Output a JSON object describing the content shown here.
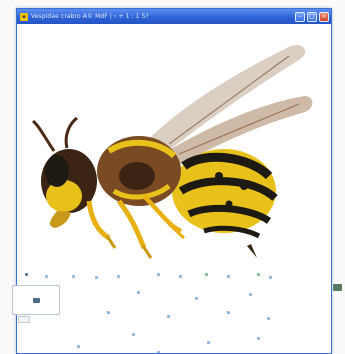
{
  "window": {
    "title": "Vespidae crabro Â© MdF  | ‹ +  1 : 1 5?",
    "minimize_glyph": "–",
    "maximize_glyph": "□",
    "close_glyph": "×"
  },
  "image": {
    "subject": "hornet",
    "colors": {
      "yellow": "#e8c21a",
      "black": "#1d1a14",
      "brown": "#7a4a22",
      "wing": "#c9b9a6"
    }
  },
  "accent": {
    "titlebar": "#2f63d6",
    "close": "#d0452a"
  }
}
